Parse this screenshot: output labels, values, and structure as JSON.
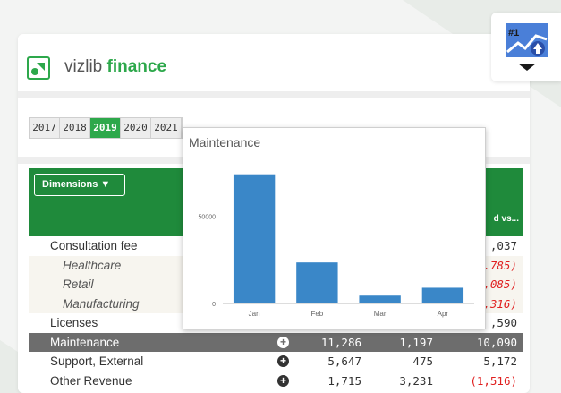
{
  "app": {
    "brand_prefix": "vizlib",
    "brand_suffix": "finance"
  },
  "years": [
    {
      "label": "2017",
      "active": false
    },
    {
      "label": "2018",
      "active": false
    },
    {
      "label": "2019",
      "active": true
    },
    {
      "label": "2020",
      "active": false
    },
    {
      "label": "2021",
      "active": false
    }
  ],
  "table": {
    "dimensions_label": "Dimensions ▼",
    "last_column_header": "d vs...",
    "rows": [
      {
        "label": "Consultation fee",
        "type": "parent",
        "c3": ",037"
      },
      {
        "label": "Healthcare",
        "type": "sub",
        "c3": ".785)",
        "neg": true
      },
      {
        "label": "Retail",
        "type": "sub",
        "c3": ",085)",
        "neg": true
      },
      {
        "label": "Manufacturing",
        "type": "sub",
        "c3": ",316)",
        "neg": true
      },
      {
        "label": "Licenses",
        "type": "parent",
        "c3": ",590"
      },
      {
        "label": "Maintenance",
        "type": "selected",
        "c1": "11,286",
        "c2": "1,197",
        "c3": "10,090"
      },
      {
        "label": "Support, External",
        "type": "parent",
        "c1": "5,647",
        "c2": "475",
        "c3": "5,172"
      },
      {
        "label": "Other Revenue",
        "type": "parent",
        "c1": "1,715",
        "c2": "3,231",
        "c3": "(1,516)",
        "neg": true
      }
    ]
  },
  "badge": {
    "label": "#1"
  },
  "popup": {
    "title": "Maintenance",
    "chart_data": {
      "type": "bar",
      "categories": [
        "Jan",
        "Feb",
        "Mar",
        "Apr"
      ],
      "values": [
        74000,
        23500,
        4500,
        9000
      ],
      "ylim": [
        0,
        80000
      ],
      "yticks": [
        0,
        50000
      ],
      "ytick_labels": [
        "0",
        "50000"
      ],
      "bar_color": "#3a87c8"
    }
  },
  "colors": {
    "accent": "#2da84b",
    "header_green": "#1f8a3b",
    "negative": "#e02020"
  }
}
